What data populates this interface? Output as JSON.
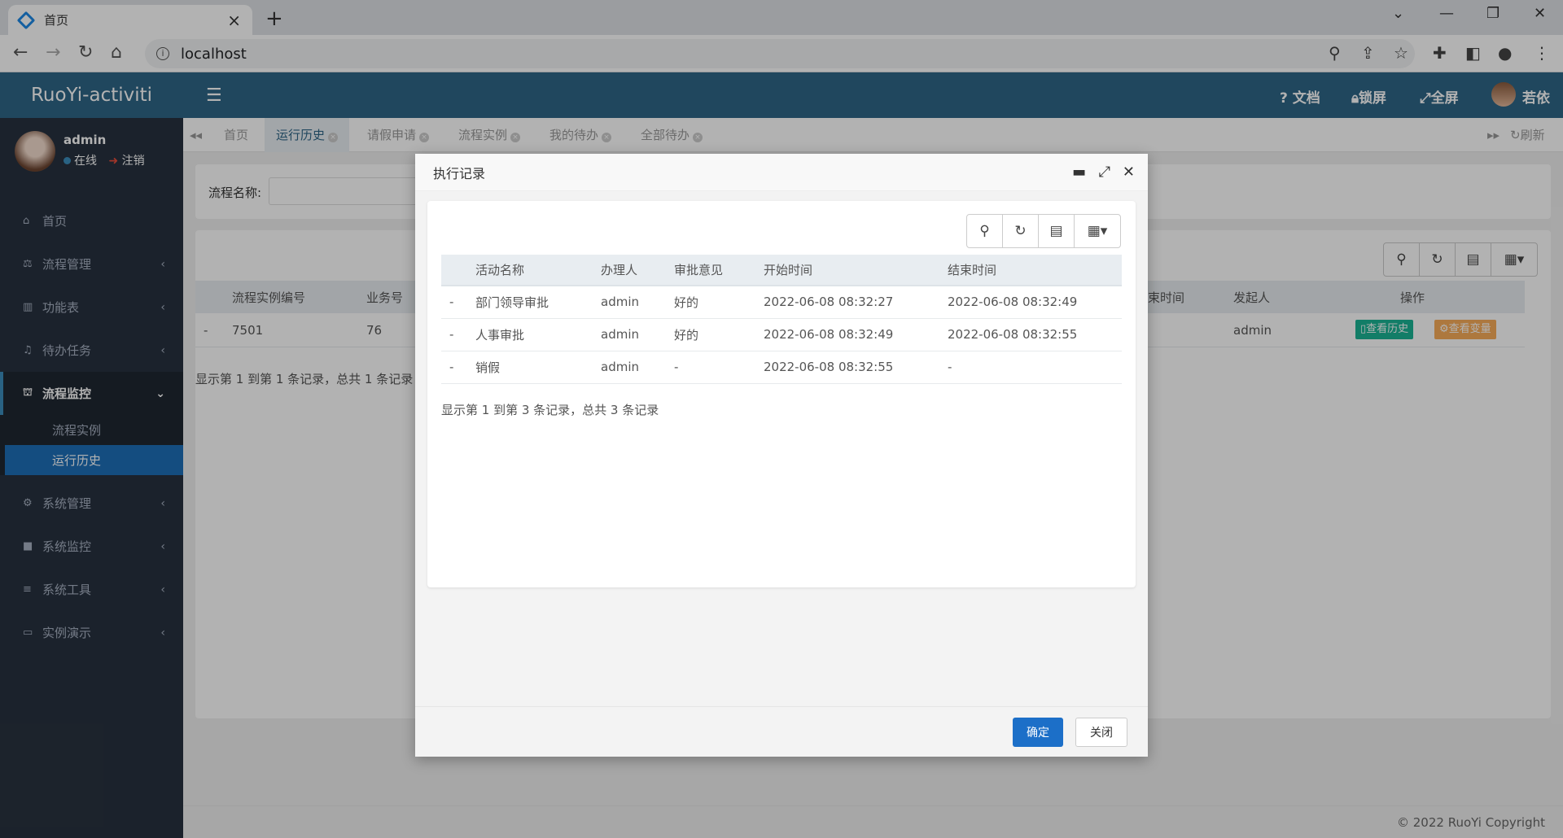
{
  "browser": {
    "tab_title": "首页",
    "url": "localhost"
  },
  "app": {
    "logo": "RuoYi-activiti",
    "topnav": {
      "docs": "文档",
      "lock": "锁屏",
      "fullscreen": "全屏",
      "user": "若依"
    },
    "user": {
      "name": "admin",
      "status": "在线",
      "logout": "注销"
    },
    "menu": [
      {
        "label": "首页",
        "icon": "home-icon"
      },
      {
        "label": "流程管理",
        "icon": "scale-icon"
      },
      {
        "label": "功能表",
        "icon": "bank-icon"
      },
      {
        "label": "待办任务",
        "icon": "bell-icon"
      },
      {
        "label": "流程监控",
        "icon": "binoculars-icon"
      },
      {
        "label": "系统管理",
        "icon": "gear-icon"
      },
      {
        "label": "系统监控",
        "icon": "video-icon"
      },
      {
        "label": "系统工具",
        "icon": "bars-icon"
      },
      {
        "label": "实例演示",
        "icon": "desktop-icon"
      }
    ],
    "submenu": [
      "流程实例",
      "运行历史"
    ],
    "page_tabs": [
      "首页",
      "运行历史",
      "请假申请",
      "流程实例",
      "我的待办",
      "全部待办"
    ],
    "refresh": "刷新",
    "search_label": "流程名称:",
    "bg_table": {
      "headers": [
        "流程实例编号",
        "业务号",
        "束时间",
        "发起人",
        "操作"
      ],
      "row": {
        "dash": "-",
        "id": "7501",
        "biz": "76",
        "starter": "admin",
        "btn_history": "查看历史",
        "btn_vars": "查看变量"
      },
      "summary": "显示第 1 到第 1 条记录，总共 1 条记录"
    },
    "footer": "© 2022 RuoYi Copyright"
  },
  "modal": {
    "title": "执行记录",
    "headers": [
      "活动名称",
      "办理人",
      "审批意见",
      "开始时间",
      "结束时间"
    ],
    "rows": [
      {
        "dash": "-",
        "activity": "部门领导审批",
        "assignee": "admin",
        "comment": "好的",
        "start": "2022-06-08 08:32:27",
        "end": "2022-06-08 08:32:49"
      },
      {
        "dash": "-",
        "activity": "人事审批",
        "assignee": "admin",
        "comment": "好的",
        "start": "2022-06-08 08:32:49",
        "end": "2022-06-08 08:32:55"
      },
      {
        "dash": "-",
        "activity": "销假",
        "assignee": "admin",
        "comment": "-",
        "start": "2022-06-08 08:32:55",
        "end": "-"
      }
    ],
    "summary": "显示第 1 到第 3 条记录，总共 3 条记录",
    "ok": "确定",
    "close": "关闭"
  },
  "colors": {
    "primary": "#1c6fc8",
    "header": "#2f6687",
    "sidebar": "#28323f",
    "success": "#1ab394",
    "warning": "#f8ac59"
  }
}
